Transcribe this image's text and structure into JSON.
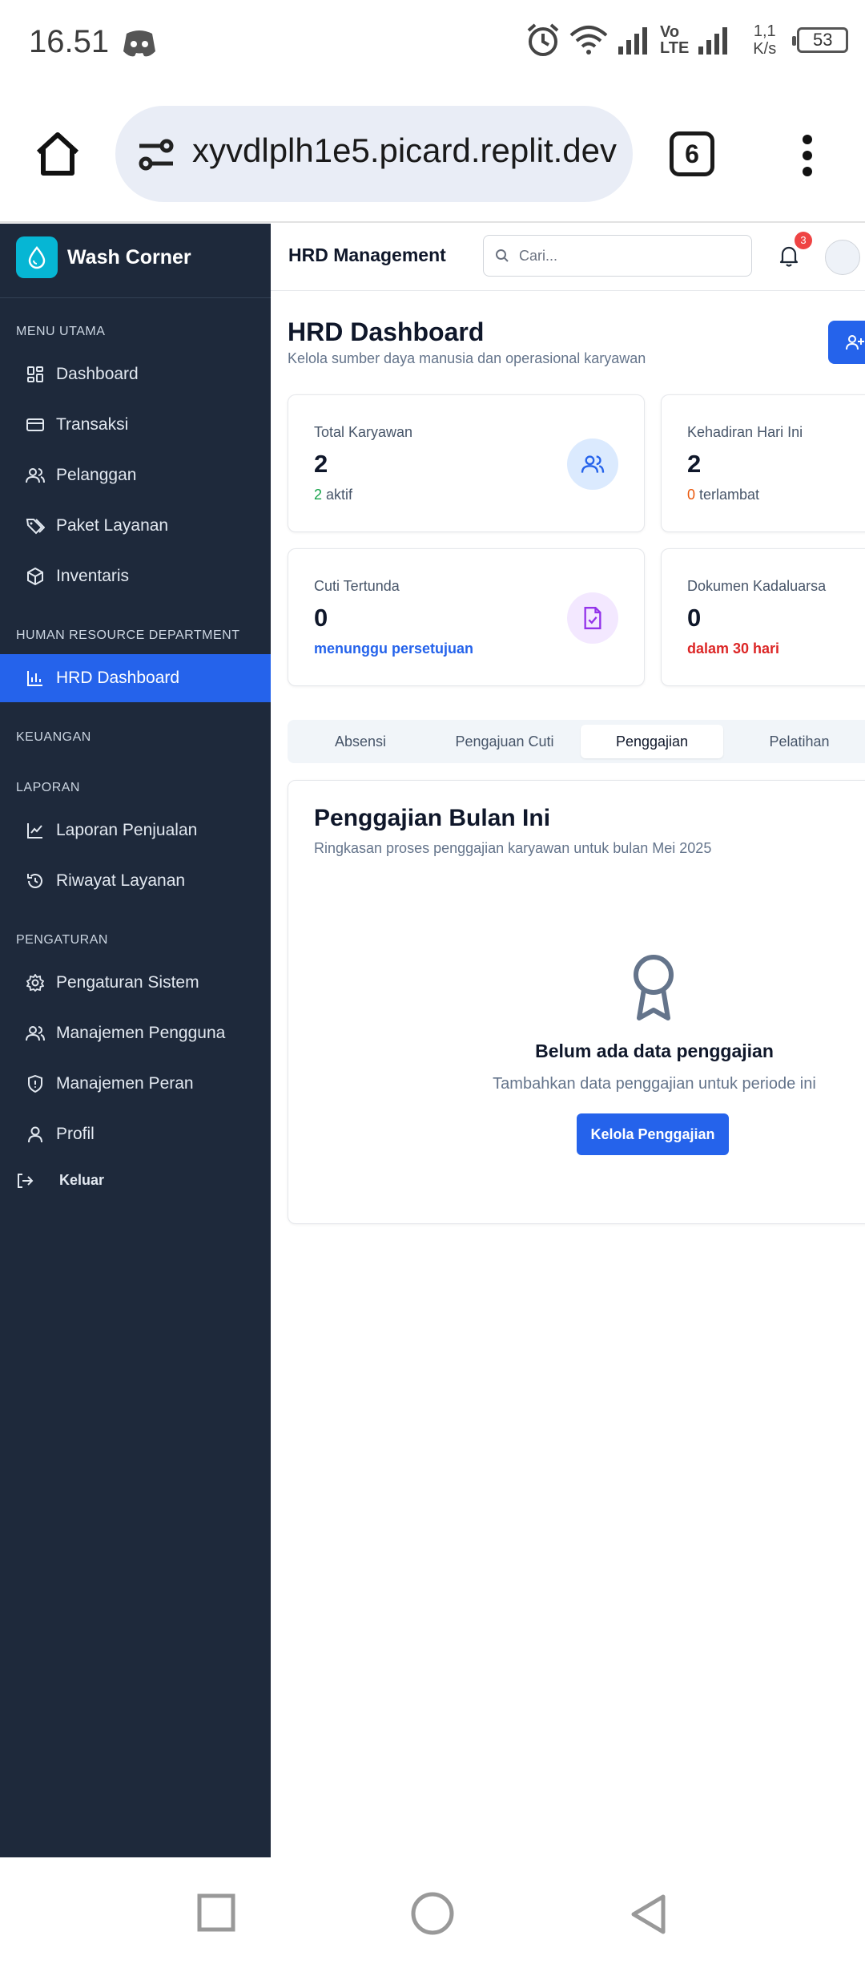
{
  "status_bar": {
    "time": "16.51",
    "network_speed": "1,1\nK/s",
    "lte_label": "Vo\nLTE",
    "battery": "53"
  },
  "browser": {
    "url": "xyvdlplh1e5.picard.replit.dev",
    "tab_count": "6"
  },
  "sidebar": {
    "brand": "Wash Corner",
    "sections": {
      "menu_utama": "MENU UTAMA",
      "hrd": "HUMAN RESOURCE DEPARTMENT",
      "keuangan": "KEUANGAN",
      "laporan": "LAPORAN",
      "pengaturan": "PENGATURAN"
    },
    "items": {
      "dashboard": "Dashboard",
      "transaksi": "Transaksi",
      "pelanggan": "Pelanggan",
      "paket_layanan": "Paket Layanan",
      "inventaris": "Inventaris",
      "hrd_dashboard": "HRD Dashboard",
      "laporan_penjualan": "Laporan Penjualan",
      "riwayat_layanan": "Riwayat Layanan",
      "pengaturan_sistem": "Pengaturan Sistem",
      "manajemen_pengguna": "Manajemen Pengguna",
      "manajemen_peran": "Manajemen Peran",
      "profil": "Profil"
    },
    "logout": "Keluar"
  },
  "header": {
    "title": "HRD Management",
    "search_placeholder": "Cari...",
    "notification_count": "3"
  },
  "page": {
    "title": "HRD Dashboard",
    "subtitle": "Kelola sumber daya manusia dan operasional karyawan"
  },
  "cards": {
    "total_karyawan": {
      "label": "Total Karyawan",
      "value": "2",
      "note_num": "2",
      "note_text": " aktif"
    },
    "kehadiran": {
      "label": "Kehadiran Hari Ini",
      "value": "2",
      "note_num": "0",
      "note_text": " terlambat"
    },
    "cuti": {
      "label": "Cuti Tertunda",
      "value": "0",
      "note": "menunggu persetujuan"
    },
    "dokumen": {
      "label": "Dokumen Kadaluarsa",
      "value": "0",
      "note": "dalam 30 hari"
    }
  },
  "tabs": {
    "absensi": "Absensi",
    "pengajuan_cuti": "Pengajuan Cuti",
    "penggajian": "Penggajian",
    "pelatihan": "Pelatihan"
  },
  "payroll": {
    "title": "Penggajian Bulan Ini",
    "description": "Ringkasan proses penggajian karyawan untuk bulan Mei 2025",
    "empty_title": "Belum ada data penggajian",
    "empty_desc": "Tambahkan data penggajian untuk periode ini",
    "button": "Kelola Penggajian"
  },
  "colors": {
    "sidebar_bg": "#1e293b",
    "accent": "#2563eb",
    "brand_logo": "#06b6d4",
    "success": "#16a34a",
    "warning": "#ea580c",
    "danger": "#dc2626",
    "info": "#2563eb"
  },
  "icons": {
    "home": "home-icon",
    "site_settings": "tune-icon",
    "more": "kebab-icon",
    "logo": "droplet-icon",
    "dashboard": "grid-icon",
    "transaksi": "credit-card-icon",
    "pelanggan": "users-icon",
    "paket": "tags-icon",
    "inventaris": "package-icon",
    "hrd": "bar-chart-icon",
    "laporan_penjualan": "line-chart-icon",
    "riwayat": "history-icon",
    "pengaturan": "gear-icon",
    "manajemen_pengguna": "users-icon",
    "manajemen_peran": "shield-icon",
    "profil": "user-icon",
    "logout": "logout-icon",
    "search": "search-icon",
    "bell": "bell-icon",
    "award": "award-icon"
  }
}
